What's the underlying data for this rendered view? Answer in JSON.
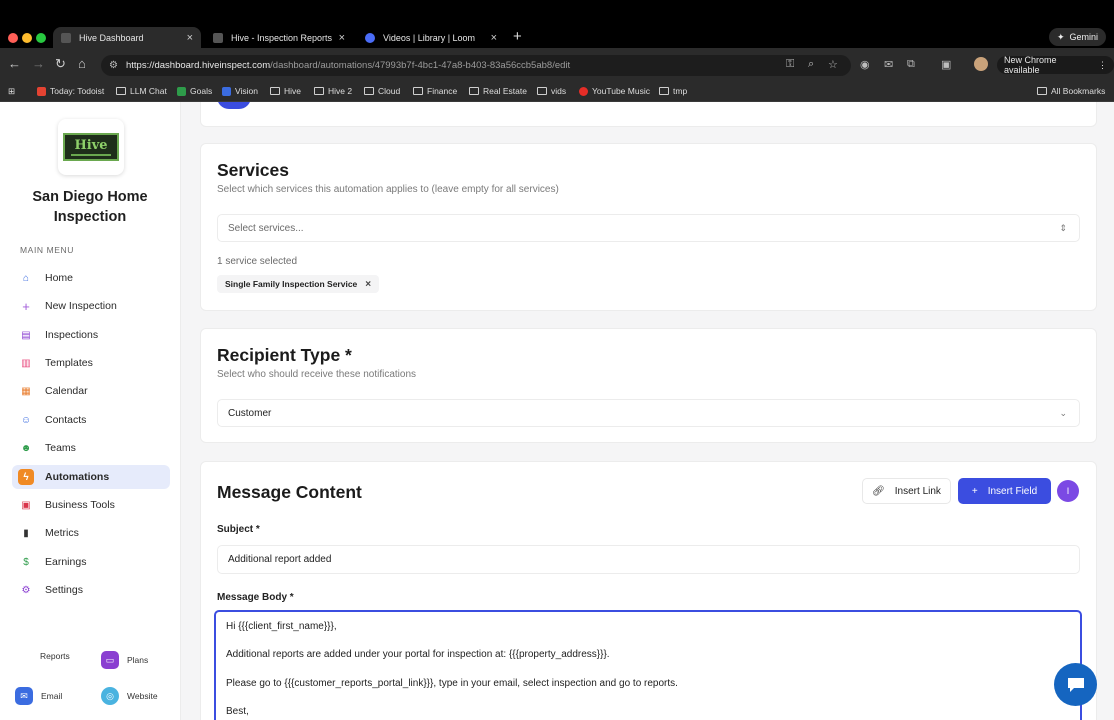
{
  "browser": {
    "tabs": [
      {
        "label": "Hive Dashboard",
        "active": true
      },
      {
        "label": "Hive - Inspection Reports",
        "active": false
      },
      {
        "label": "Videos | Library | Loom",
        "active": false
      }
    ],
    "gemini_label": "Gemini",
    "url_host": "https://dashboard.hiveinspect.com",
    "url_path": "/dashboard/automations/47993b7f-4bc1-47a8-b403-83a56ccb5ab8/edit",
    "new_chrome_label": "New Chrome available",
    "bookmarks": [
      "Today: Todoist",
      "LLM Chat",
      "Goals",
      "Vision",
      "Hive",
      "Hive 2",
      "Cloud",
      "Finance",
      "Real Estate",
      "vids",
      "YouTube Music",
      "tmp"
    ],
    "all_bookmarks_label": "All Bookmarks"
  },
  "sidebar": {
    "company_name": "San Diego Home Inspection",
    "menu_title": "MAIN MENU",
    "items": [
      {
        "label": "Home",
        "icon": "home-icon"
      },
      {
        "label": "New Inspection",
        "icon": "plus-icon"
      },
      {
        "label": "Inspections",
        "icon": "clipboard-icon"
      },
      {
        "label": "Templates",
        "icon": "document-icon"
      },
      {
        "label": "Calendar",
        "icon": "calendar-icon"
      },
      {
        "label": "Contacts",
        "icon": "users-icon"
      },
      {
        "label": "Teams",
        "icon": "team-icon"
      },
      {
        "label": "Automations",
        "icon": "lightning-icon",
        "active": true
      },
      {
        "label": "Business Tools",
        "icon": "briefcase-icon"
      },
      {
        "label": "Metrics",
        "icon": "bar-chart-icon"
      },
      {
        "label": "Earnings",
        "icon": "dollar-icon"
      },
      {
        "label": "Settings",
        "icon": "gear-icon"
      }
    ],
    "footer": {
      "reports": "Reports",
      "plans": "Plans",
      "email": "Email",
      "website": "Website"
    }
  },
  "services": {
    "title": "Services",
    "subtitle": "Select which services this automation applies to (leave empty for all services)",
    "placeholder": "Select services...",
    "count_text": "1 service selected",
    "selected": [
      "Single Family Inspection Service"
    ]
  },
  "recipient": {
    "title": "Recipient Type *",
    "subtitle": "Select who should receive these notifications",
    "value": "Customer"
  },
  "message": {
    "title": "Message Content",
    "insert_link": "Insert Link",
    "insert_field": "Insert Field",
    "avatar_initial": "I",
    "subject_label": "Subject *",
    "subject_value": "Additional report added",
    "body_label": "Message Body *",
    "body_lines": [
      "Hi {{{client_first_name}}},",
      "Additional reports are added under your portal for inspection at: {{{property_address}}}.",
      "Please go to {{{customer_reports_portal_link}}}, type in your email, select inspection and go to reports.",
      "Best,"
    ]
  }
}
